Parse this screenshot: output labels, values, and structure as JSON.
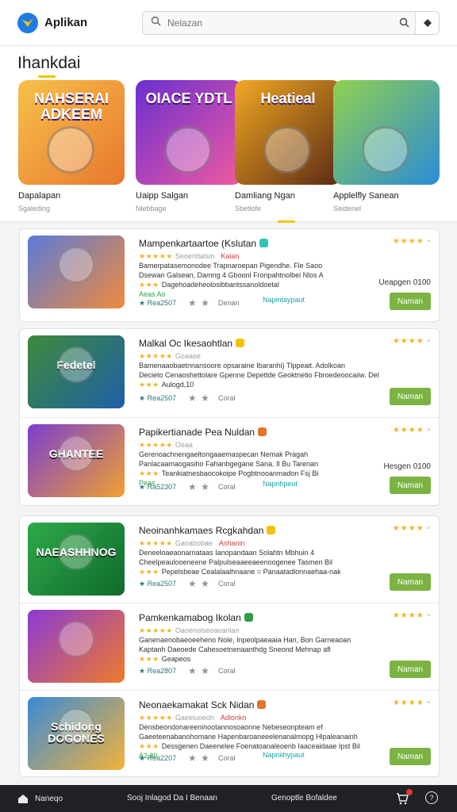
{
  "header": {
    "app_title": "Aplikan",
    "search_placeholder": "Nelazan",
    "logo_icon": "bird-logo-icon",
    "brand_color": "#1e7be3"
  },
  "featured": {
    "heading": "Ihankdai",
    "tiles": [
      {
        "name": "Dapalapan",
        "sub": "Sgaleding",
        "art_text": "NAHSERAI ADKEEM",
        "colors": [
          "#f6c14a",
          "#e8772e"
        ]
      },
      {
        "name": "Uaipp Salgan",
        "sub": "Nlebbage",
        "art_text": "OIACE YDTL",
        "colors": [
          "#6a2fd0",
          "#f05aa0"
        ]
      },
      {
        "name": "Damliang Ngan",
        "sub": "Sbetlofe",
        "art_text": "Heatieal",
        "colors": [
          "#f2a823",
          "#5a2a14"
        ]
      },
      {
        "name": "Applelfly Sanean",
        "sub": "Seidenel",
        "art_text": "",
        "colors": [
          "#8fd14f",
          "#2b8bd6"
        ]
      }
    ]
  },
  "list": {
    "items": [
      {
        "title": "Mampenkartaartoe (Kslutan",
        "badge_color": "#2ec4b6",
        "rating_stars": "★★★★",
        "line1_a": "Seoerldalsin",
        "line1_b": "Kaian",
        "line2": "Bamerpatasemonodee Trapnaroepan Pigendhe. Fle Saoo",
        "line3": "Dsewan Galsean, Damng 4 Gboonl Fronpahtnolbei Nlos A",
        "line4": "Dagehoadeheolosibbantssanoldoetal",
        "line5": "Aeas Ao",
        "price_label": "Ueapgen 0100",
        "views": "Rea2507",
        "category": "Denan",
        "tagline": "Napintaypaut",
        "download": "Naman",
        "thumb_colors": [
          "#5a7bd8",
          "#f08a3c"
        ],
        "thumb_text": ""
      },
      {
        "title": "Malkal Oc Ikesaohtlan",
        "badge_color": "#f2c200",
        "rating_stars": "★★★★",
        "line1_a": "Goaaee",
        "line1_b": "",
        "line2": "Bamenaaobaetnnansoore opsaraine Ibaranhi) Tlppeait. Adolkoan",
        "line3": "Decieto Cenaoshettolare Gpenne Depettde Geoktnetio Fbroedeoocaiiw. Del",
        "line4": "Aulogd,10",
        "line5": "",
        "price_label": "",
        "views": "Rea2507",
        "category": "Coral",
        "tagline": "",
        "download": "Naman",
        "thumb_colors": [
          "#3d8a3a",
          "#1f5fa8"
        ],
        "thumb_text": "Fedetel"
      },
      {
        "title": "Papikertianade Pea Nuldan",
        "badge_color": "#e2752a",
        "rating_stars": "★★★★",
        "line1_a": "Oeaa",
        "line1_b": "",
        "line2": "Gerenoachnengaeltongaaemaspecan Nemak Pragah",
        "line3": "Panlacaamaogasiho Fahanbgegane Sana. Il Bu Tarenan",
        "line4": "Teankiatnesbaocokoipe Pogbtnooanmadon Fsj Bi",
        "line5": "Peas",
        "price_label": "Hesgen 0100",
        "views": "Ra52307",
        "category": "Coral",
        "tagline": "Napnhpeut",
        "download": "Naman",
        "thumb_colors": [
          "#7b3fcf",
          "#f0a030"
        ],
        "thumb_text": "GHANTEE"
      },
      {
        "title": "Neoinanhkamaes Rcgkahdan",
        "badge_color": "#f2c200",
        "rating_stars": "★★★★",
        "line1_a": "Gaoabobae",
        "line1_b": "Ashanin",
        "line2": "Deneeloaeaonarnataas Ianopandaan Solahtn Mbhuin 4",
        "line3": "Cheelpeaulooeneene Palpulseaaeeaeenoogenee Tasmen Bil",
        "line4": "Pepelsbeae Cealalaalhnaane = Panaatadlonnaehaa-nak",
        "line5": "",
        "price_label": "",
        "views": "Rea2507",
        "category": "Coral",
        "tagline": "",
        "download": "Naman",
        "thumb_colors": [
          "#2fa84a",
          "#0f6b2c"
        ],
        "thumb_text": "NAEASHHNOG"
      },
      {
        "title": "Pamkenkamabog Ikolan",
        "badge_color": "#2f9e44",
        "rating_stars": "★★★★",
        "line1_a": "Oaoenolseoaeanlan",
        "line1_b": "",
        "line2": "Ganenaenobaeoeeheno Nole, Inpeolpaeaaia Han, Bon Garneaoan",
        "line3": "Kaptanh Daeoede Cahesoetnenaanthdg Sneond Mehnap afl",
        "line4": "Geapeos",
        "line5": "",
        "price_label": "",
        "views": "Rea2807",
        "category": "Coral",
        "tagline": "",
        "download": "Naman",
        "thumb_colors": [
          "#8a3ad6",
          "#f07a2a"
        ],
        "thumb_text": ""
      },
      {
        "title": "Neonaekamakat Sck Nidan",
        "badge_color": "#e2752a",
        "rating_stars": "★★★★",
        "line1_a": "Gaeeiuoeoh",
        "line1_b": "Adlonkn",
        "line2": "Densbeondonareeninootannosoaonne Nebeseonpteam ef",
        "line3": "Gaeeteenabanohomane Hapenbaroaneeelenanalmopg Hlpaleanainh",
        "line4": "Dessgenen Daeenelee Foenatoanaleoenb Iaaceaidaae Ipst Bil",
        "line5": "A2,80",
        "price_label": "",
        "views": "Rea2207",
        "category": "Coral",
        "tagline": "Napniihypaut",
        "download": "Naman",
        "thumb_colors": [
          "#3a8ad6",
          "#f2b23a"
        ],
        "thumb_text": "Schidong DOGONES"
      }
    ]
  },
  "navbar": {
    "home_label": "Naneqo",
    "mid_label": "Sooj Inlagod Da I Benaan",
    "right_label": "Genoptle Bofaldee",
    "help_glyph": "?",
    "icons": [
      "home-icon",
      "cart-icon",
      "help-icon"
    ]
  }
}
